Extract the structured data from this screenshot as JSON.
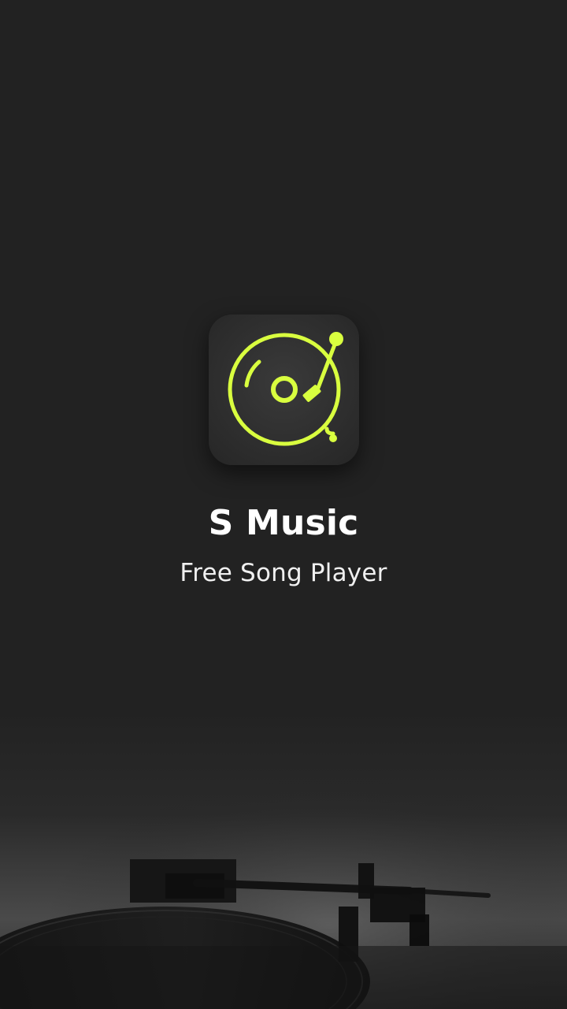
{
  "app": {
    "title": "S Music",
    "subtitle": "Free Song Player"
  },
  "logo": {
    "icon": "turntable-icon",
    "accent_color": "#D9FF3F",
    "background_color": "#2F2F2F"
  },
  "background": {
    "base_color": "#222222",
    "illustration_icon": "turntable-background-icon"
  }
}
